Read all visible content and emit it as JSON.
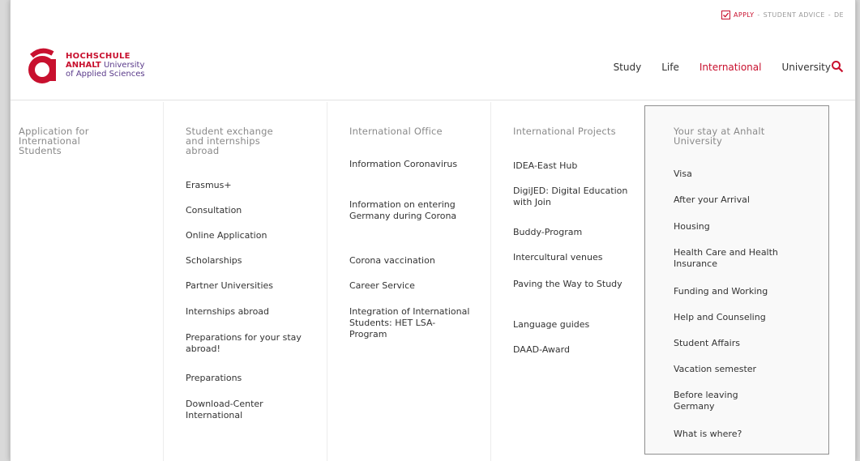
{
  "topbar": {
    "apply_label": "APPLY",
    "separator": "-",
    "student_advice_label": "STUDENT ADVICE",
    "lang_label": "DE"
  },
  "logo": {
    "line1": "HOCHSCHULE",
    "line2_bold": "ANHALT",
    "line2_rest": " University",
    "line3": "of Applied Sciences"
  },
  "nav": {
    "items": [
      "Study",
      "Life",
      "International",
      "University"
    ]
  },
  "colors": {
    "brand_red": "#c8102e",
    "brand_purple": "#5a3a8a"
  },
  "menu": {
    "col1": {
      "title": "Application for International Students"
    },
    "col2": {
      "title": "Student exchange and internships abroad",
      "items": [
        "Erasmus+",
        "Consultation",
        "Online Application",
        "Scholarships",
        "Partner Universities",
        "Internships abroad",
        "Preparations for your stay abroad!",
        "Preparations",
        "Download-Center International"
      ]
    },
    "col3": {
      "title": "International Office",
      "items": [
        "Information Coronavirus",
        "Information on entering Germany during Corona",
        "Corona vaccination",
        "Career Service",
        "Integration of International Students: HET LSA-Program"
      ]
    },
    "col4": {
      "title": "International Projects",
      "items": [
        "IDEA-East Hub",
        "DigiJED: Digital Education with Join",
        "Buddy-Program",
        "Intercultural venues",
        "Paving the Way to Study",
        "Language guides",
        "DAAD-Award"
      ]
    },
    "col5": {
      "title": "Your stay at Anhalt University",
      "items": [
        "Visa",
        "After your Arrival",
        "Housing",
        "Health Care and Health Insurance",
        "Funding and Working",
        "Help and Counseling",
        "Student Affairs",
        "Vacation semester",
        "Before leaving Germany",
        "What is where?"
      ]
    }
  }
}
